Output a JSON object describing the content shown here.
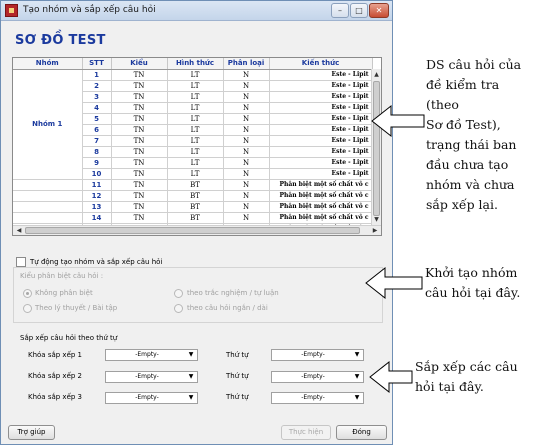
{
  "window": {
    "title": "Tạo nhóm và sắp xếp câu hỏi",
    "min_symbol": "–",
    "max_symbol": "□",
    "close_symbol": "✕"
  },
  "heading": "SƠ ĐỒ TEST",
  "grid": {
    "columns": [
      "Nhóm",
      "STT",
      "Kiểu",
      "Hình thức",
      "Phân loại",
      "Kiến thức"
    ],
    "group_label": "Nhóm 1",
    "rows": [
      {
        "stt": "1",
        "kieu": "TN",
        "hinh_thuc": "LT",
        "phan_loai": "N",
        "kien_thuc": "Este - Lipit"
      },
      {
        "stt": "2",
        "kieu": "TN",
        "hinh_thuc": "LT",
        "phan_loai": "N",
        "kien_thuc": "Este - Lipit"
      },
      {
        "stt": "3",
        "kieu": "TN",
        "hinh_thuc": "LT",
        "phan_loai": "N",
        "kien_thuc": "Este - Lipit"
      },
      {
        "stt": "4",
        "kieu": "TN",
        "hinh_thuc": "LT",
        "phan_loai": "N",
        "kien_thuc": "Este - Lipit"
      },
      {
        "stt": "5",
        "kieu": "TN",
        "hinh_thuc": "LT",
        "phan_loai": "N",
        "kien_thuc": "Este - Lipit"
      },
      {
        "stt": "6",
        "kieu": "TN",
        "hinh_thuc": "LT",
        "phan_loai": "N",
        "kien_thuc": "Este - Lipit"
      },
      {
        "stt": "7",
        "kieu": "TN",
        "hinh_thuc": "LT",
        "phan_loai": "N",
        "kien_thuc": "Este - Lipit"
      },
      {
        "stt": "8",
        "kieu": "TN",
        "hinh_thuc": "LT",
        "phan_loai": "N",
        "kien_thuc": "Este - Lipit"
      },
      {
        "stt": "9",
        "kieu": "TN",
        "hinh_thuc": "LT",
        "phan_loai": "N",
        "kien_thuc": "Este - Lipit"
      },
      {
        "stt": "10",
        "kieu": "TN",
        "hinh_thuc": "LT",
        "phan_loai": "N",
        "kien_thuc": "Este - Lipit"
      },
      {
        "stt": "11",
        "kieu": "TN",
        "hinh_thuc": "BT",
        "phan_loai": "N",
        "kien_thuc": "Phân biệt một số chất vô c"
      },
      {
        "stt": "12",
        "kieu": "TN",
        "hinh_thuc": "BT",
        "phan_loai": "N",
        "kien_thuc": "Phân biệt một số chất vô c"
      },
      {
        "stt": "13",
        "kieu": "TN",
        "hinh_thuc": "BT",
        "phan_loai": "N",
        "kien_thuc": "Phân biệt một số chất vô c"
      },
      {
        "stt": "14",
        "kieu": "TN",
        "hinh_thuc": "BT",
        "phan_loai": "N",
        "kien_thuc": "Phân biệt một số chất vô c"
      },
      {
        "stt": "",
        "kieu": "",
        "hinh_thuc": "",
        "phan_loai": "",
        "kien_thuc": "Phân biệt một số chất vô c"
      }
    ]
  },
  "auto_group": {
    "label": "Tự động tạo nhóm và sắp xếp câu hỏi",
    "checked": false,
    "fieldset_title": "Kiểu phân biệt câu hỏi :",
    "options": [
      {
        "label": "Không phân biệt",
        "selected": true
      },
      {
        "label": "theo trắc nghiệm / tự luận",
        "selected": false
      },
      {
        "label": "Theo lý thuyết / Bài tập",
        "selected": false
      },
      {
        "label": "theo câu hỏi ngắn / dài",
        "selected": false
      }
    ]
  },
  "sort": {
    "title": "Sắp xếp câu hỏi theo thứ tự",
    "key_label_1": "Khóa sắp xếp 1",
    "key_label_2": "Khóa sắp xếp 2",
    "key_label_3": "Khóa sắp xếp 3",
    "order_label": "Thứ tự",
    "empty_value": "-Empty-",
    "dropdown_symbol": "▼"
  },
  "buttons": {
    "help": "Trợ giúp",
    "run": "Thực hiện",
    "close": "Đóng"
  },
  "annotations": {
    "note1": [
      "DS câu hỏi của",
      "đề kiểm tra (theo",
      "Sơ đồ Test),",
      "trạng thái ban",
      "đầu chưa tạo",
      "nhóm và chưa",
      "sắp xếp lại."
    ],
    "note2": [
      "Khởi tạo nhóm",
      "câu hỏi tại đây."
    ],
    "note3": [
      "Sắp xếp các câu",
      "hỏi tại đây."
    ]
  }
}
